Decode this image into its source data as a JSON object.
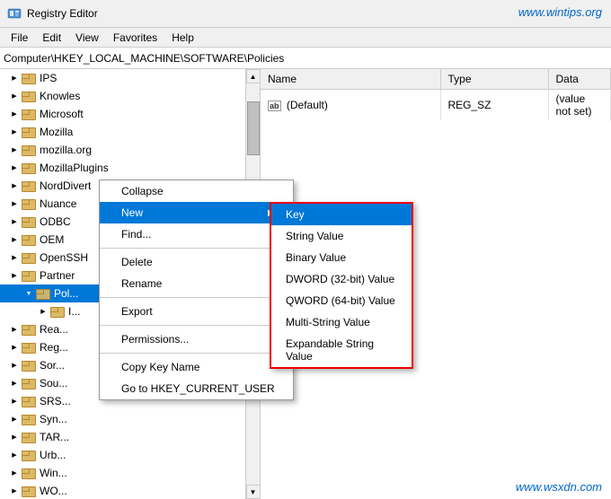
{
  "titleBar": {
    "title": "Registry Editor",
    "icon": "regedit"
  },
  "watermark": "www.wintips.org",
  "watermark2": "www.wsxdn.com",
  "menuBar": {
    "items": [
      "File",
      "Edit",
      "View",
      "Favorites",
      "Help"
    ]
  },
  "addressBar": {
    "path": "Computer\\HKEY_LOCAL_MACHINE\\SOFTWARE\\Policies"
  },
  "tableHeaders": {
    "name": "Name",
    "type": "Type",
    "data": "Data"
  },
  "tableRows": [
    {
      "name": "(Default)",
      "type": "REG_SZ",
      "data": "(value not set)"
    }
  ],
  "treeItems": [
    {
      "label": "IPS",
      "indent": 2,
      "arrow": "collapsed"
    },
    {
      "label": "Knowles",
      "indent": 2,
      "arrow": "collapsed"
    },
    {
      "label": "Microsoft",
      "indent": 2,
      "arrow": "collapsed"
    },
    {
      "label": "Mozilla",
      "indent": 2,
      "arrow": "collapsed"
    },
    {
      "label": "mozilla.org",
      "indent": 2,
      "arrow": "collapsed"
    },
    {
      "label": "MozillaPlugins",
      "indent": 2,
      "arrow": "collapsed"
    },
    {
      "label": "NordDivert",
      "indent": 2,
      "arrow": "collapsed"
    },
    {
      "label": "Nuance",
      "indent": 2,
      "arrow": "collapsed"
    },
    {
      "label": "ODBC",
      "indent": 2,
      "arrow": "collapsed"
    },
    {
      "label": "OEM",
      "indent": 2,
      "arrow": "collapsed"
    },
    {
      "label": "OpenSSH",
      "indent": 2,
      "arrow": "collapsed"
    },
    {
      "label": "Partner",
      "indent": 2,
      "arrow": "collapsed"
    },
    {
      "label": "Policies",
      "indent": 2,
      "arrow": "expanded",
      "selected": true
    },
    {
      "label": "Rea...",
      "indent": 2,
      "arrow": "collapsed"
    },
    {
      "label": "Reg...",
      "indent": 2,
      "arrow": "collapsed"
    },
    {
      "label": "Sor...",
      "indent": 2,
      "arrow": "collapsed"
    },
    {
      "label": "Sou...",
      "indent": 2,
      "arrow": "collapsed"
    },
    {
      "label": "SRS...",
      "indent": 2,
      "arrow": "collapsed"
    },
    {
      "label": "Syn...",
      "indent": 2,
      "arrow": "collapsed"
    },
    {
      "label": "TAR...",
      "indent": 2,
      "arrow": "collapsed"
    },
    {
      "label": "Urb...",
      "indent": 2,
      "arrow": "collapsed"
    },
    {
      "label": "Win...",
      "indent": 2,
      "arrow": "collapsed"
    },
    {
      "label": "WO...",
      "indent": 2,
      "arrow": "collapsed"
    }
  ],
  "contextMenu": {
    "items": [
      {
        "label": "Collapse",
        "type": "item"
      },
      {
        "label": "New",
        "type": "submenu-trigger"
      },
      {
        "label": "Find...",
        "type": "item"
      },
      {
        "type": "divider"
      },
      {
        "label": "Delete",
        "type": "item"
      },
      {
        "label": "Rename",
        "type": "item"
      },
      {
        "type": "divider"
      },
      {
        "label": "Export",
        "type": "item"
      },
      {
        "type": "divider"
      },
      {
        "label": "Permissions...",
        "type": "item"
      },
      {
        "type": "divider"
      },
      {
        "label": "Copy Key Name",
        "type": "item"
      },
      {
        "label": "Go to HKEY_CURRENT_USER",
        "type": "item"
      }
    ]
  },
  "submenu": {
    "items": [
      {
        "label": "Key",
        "highlighted": true
      },
      {
        "label": "String Value"
      },
      {
        "label": "Binary Value"
      },
      {
        "label": "DWORD (32-bit) Value"
      },
      {
        "label": "QWORD (64-bit) Value"
      },
      {
        "label": "Multi-String Value"
      },
      {
        "label": "Expandable String Value"
      }
    ]
  }
}
